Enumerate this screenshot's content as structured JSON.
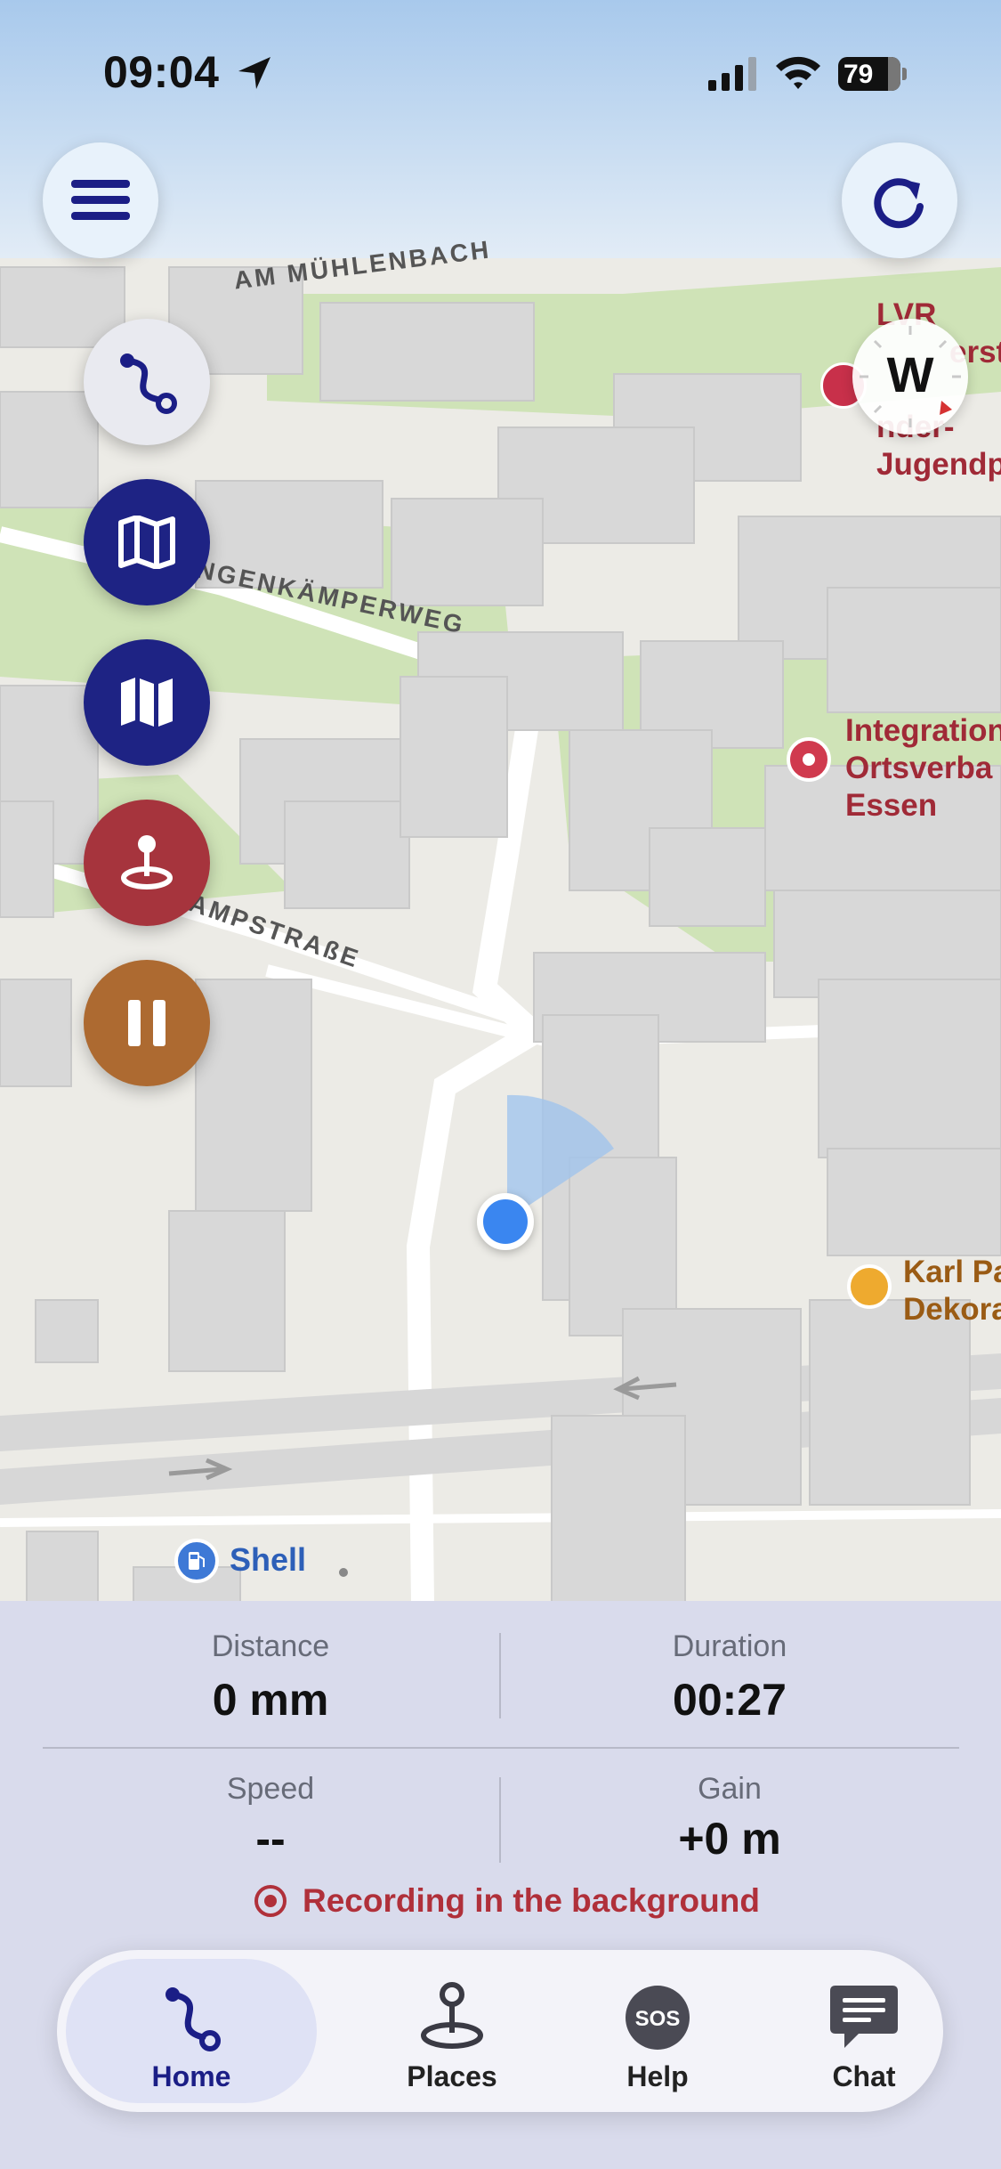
{
  "status_bar": {
    "time": "09:04",
    "battery": "79",
    "icons": [
      "location-arrow-icon",
      "signal-icon",
      "wifi-icon",
      "battery-icon"
    ]
  },
  "map": {
    "street_labels": [
      "AM MÜHLENBACH",
      "NGENKÄMPERWEG",
      "AMPSTRAßE"
    ],
    "poi_top_right": [
      "LVR",
      "erst",
      "- ",
      "nder-",
      "Jugendp"
    ],
    "poi_integration": [
      "Integration",
      "Ortsverba",
      "Essen"
    ],
    "poi_karl": [
      "Karl Pa",
      "Dekora"
    ],
    "shell_label": "Shell",
    "compass_letter": "W"
  },
  "stats": {
    "distance_label": "Distance",
    "distance_value": "0 mm",
    "duration_label": "Duration",
    "duration_value": "00:27",
    "speed_label": "Speed",
    "speed_value": "--",
    "gain_label": "Gain",
    "gain_value": "+0 m"
  },
  "recording_text": "Recording in the background",
  "tabs": [
    {
      "label": "Home",
      "icon": "route-icon",
      "active": true
    },
    {
      "label": "Places",
      "icon": "place-pin-icon",
      "active": false
    },
    {
      "label": "Help",
      "icon": "sos-icon",
      "active": false
    },
    {
      "label": "Chat",
      "icon": "chat-bubble-icon",
      "active": false
    }
  ],
  "colors": {
    "accent": "#1b1e86",
    "record_red": "#a6343d",
    "pause_brown": "#ad6a31",
    "user_location": "#3a86f0"
  }
}
